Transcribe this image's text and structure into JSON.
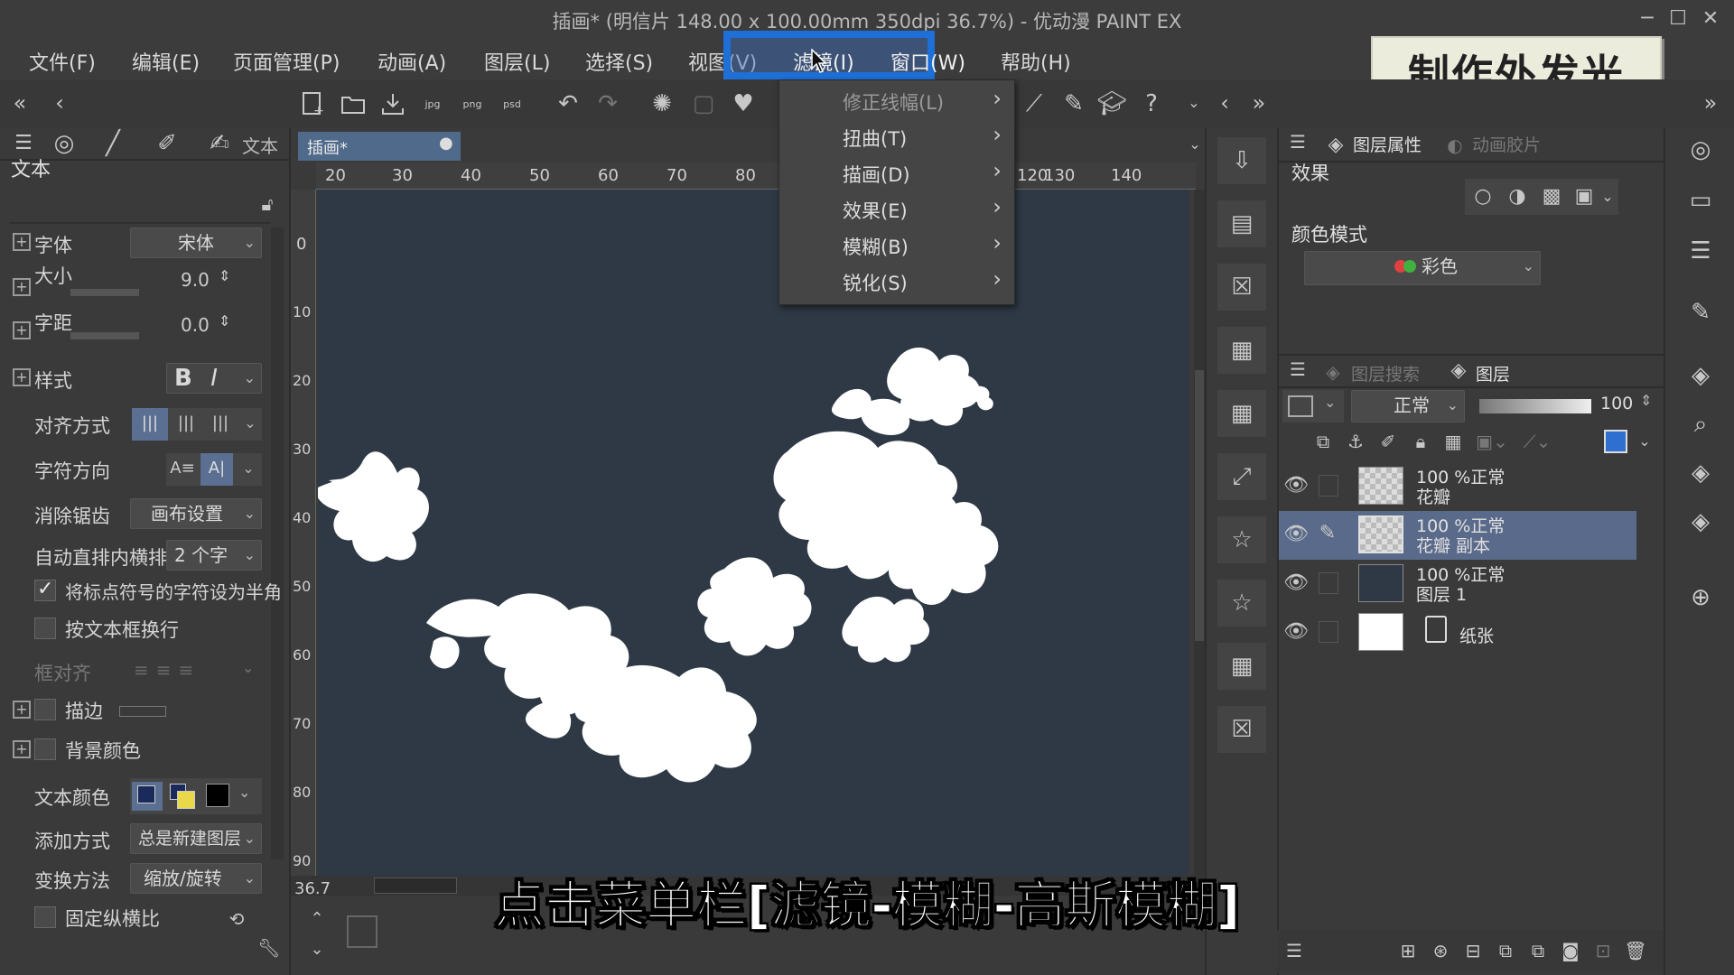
{
  "window": {
    "title": "插画* (明信片 148.00 x 100.00mm 350dpi 36.7%) - 优动漫 PAINT EX"
  },
  "menubar": {
    "items": [
      "文件(F)",
      "编辑(E)",
      "页面管理(P)",
      "动画(A)",
      "图层(L)",
      "选择(S)",
      "视图(V)",
      "滤镜(I)",
      "窗口(W)",
      "帮助(H)"
    ],
    "highlighted": "滤镜(I)",
    "highlight_color": "#1e6fd6"
  },
  "annotation": "制作外发光",
  "filter_menu": {
    "items": [
      "修正线幅(L)",
      "扭曲(T)",
      "描画(D)",
      "效果(E)",
      "模糊(B)",
      "锐化(S)"
    ]
  },
  "document": {
    "tab": "插画*",
    "zoom": "36.7",
    "ruler_top": [
      "20",
      "30",
      "40",
      "50",
      "60",
      "70",
      "80",
      "120",
      "130",
      "140"
    ],
    "ruler_left": [
      "0",
      "10",
      "20",
      "30",
      "40",
      "50",
      "60",
      "70",
      "80",
      "90"
    ],
    "canvas_color": "#2e3945"
  },
  "tool_property": {
    "tab_label": "文本",
    "section": "文本",
    "font_label": "字体",
    "font_value": "宋体",
    "size_label": "大小",
    "size_value": "9.0",
    "spacing_label": "字距",
    "spacing_value": "0.0",
    "style_label": "样式",
    "bold": "B",
    "italic": "I",
    "align_label": "对齐方式",
    "direction_label": "字符方向",
    "antialias_label": "消除锯齿",
    "antialias_value": "画布设置",
    "auto_label": "自动直排内横排",
    "auto_value": "2 个字",
    "punct_label": "将标点符号的字符设为半角",
    "punct_checked": true,
    "wrap_label": "按文本框换行",
    "frame_align_label": "框对齐",
    "stroke_label": "描边",
    "bg_color_label": "背景颜色",
    "text_color_label": "文本颜色",
    "add_method_label": "添加方式",
    "add_method_value": "总是新建图层",
    "transform_label": "变换方法",
    "transform_value": "缩放/旋转",
    "fixed_ratio_label": "固定纵横比",
    "text_color_main": "#1a2a5a",
    "text_color_sub": "#e8d84a"
  },
  "layer_property": {
    "tab_active": "图层属性",
    "tab_other": "动画胶片",
    "effect_label": "效果",
    "color_mode_label": "颜色模式",
    "color_mode_value": "彩色"
  },
  "layers_panel": {
    "tab_search": "图层搜索",
    "tab_layers": "图层",
    "blend_mode": "正常",
    "opacity": "100",
    "layers": [
      {
        "line1": "100 %正常",
        "line2": "花瓣",
        "thumb": "checker",
        "selected": false
      },
      {
        "line1": "100 %正常",
        "line2": "花瓣 副本",
        "thumb": "checker",
        "selected": true
      },
      {
        "line1": "100 %正常",
        "line2": "图层 1",
        "thumb": "dark",
        "selected": false
      },
      {
        "line1": "",
        "line2": "纸张",
        "thumb": "white",
        "selected": false
      }
    ]
  },
  "subtitle": "点击菜单栏[滤镜-模糊-高斯模糊]"
}
